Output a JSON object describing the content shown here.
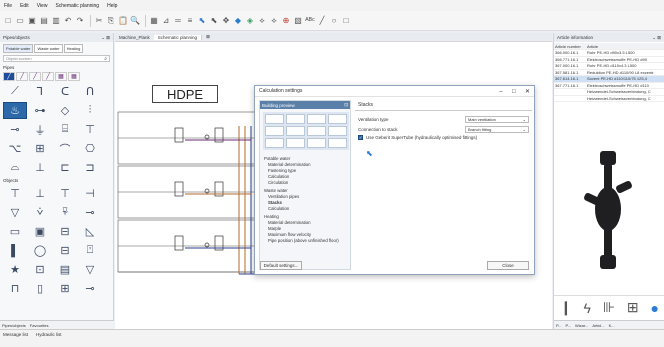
{
  "menu": [
    "File",
    "Edit",
    "View",
    "Schematic planning",
    "Help"
  ],
  "left": {
    "title": "Pipes/objects",
    "tabs": [
      "Potable water",
      "Waste water",
      "Heating"
    ],
    "search_placeholder": "Objekt suchen",
    "section_pipes": "Pipes",
    "section_objects": "Objects",
    "bottom_tabs": [
      "Pipes/objects",
      "Favourites"
    ]
  },
  "center": {
    "tabs": [
      "Machine_Plank",
      "Schematic planning"
    ],
    "hdpe_label": "HDPE"
  },
  "dialog": {
    "title": "Calculation settings",
    "left_header": "Building preview",
    "nav": [
      {
        "label": "Potable water",
        "level": 0
      },
      {
        "label": "Material determination",
        "level": 1
      },
      {
        "label": "Fastening type",
        "level": 1
      },
      {
        "label": "Calculation",
        "level": 1
      },
      {
        "label": "Circulation",
        "level": 1
      },
      {
        "label": "Waste water",
        "level": 0
      },
      {
        "label": "Ventilation pipes",
        "level": 1
      },
      {
        "label": "Stacks",
        "level": 1,
        "bold": true
      },
      {
        "label": "Calculation",
        "level": 1
      },
      {
        "label": "Heating",
        "level": 0
      },
      {
        "label": "Material determination",
        "level": 1
      },
      {
        "label": "Marple",
        "level": 1
      },
      {
        "label": "Maximum flow velocity",
        "level": 1
      },
      {
        "label": "Pipe position (above unfinished floor)",
        "level": 1
      }
    ],
    "section": "Stacks",
    "ventilation_label": "Ventilation type",
    "ventilation_value": "Main ventilation",
    "connection_label": "Connection to stack",
    "connection_value": "Branch fitting",
    "checkbox_label": "Use Geberit SuperTube (hydraulically optimised fittings)",
    "default_button": "Default settings...",
    "close_button": "Close"
  },
  "right": {
    "title": "Article information",
    "headers": [
      "Article number",
      "Article"
    ],
    "rows": [
      [
        "366.000.16.1",
        "Rohr PE-HD d90x3.5 L500"
      ],
      [
        "366.771.16.1",
        "Elektroschweissmuffe PE-HD d90"
      ],
      [
        "367.000.16.1",
        "Rohr PE-HD d110x4.3 L500"
      ],
      [
        "367.581.16.1",
        "Reduktion PE-HD d110/90 L8 exzentr"
      ],
      [
        "367.614.16.1",
        "Sovent PE-HD d110/110/75 125,4"
      ],
      [
        "367.771.16.1",
        "Elektroschweissmuffe PE-HD d110"
      ],
      [
        "",
        "Heizwendel-Schweissverbindung, C"
      ],
      [
        "",
        "Heizwendel-Schweissverbindung, C"
      ]
    ],
    "selected_row": 4,
    "bottom_tabs": [
      "P...",
      "P...",
      "Wizar...",
      "Articl...",
      "K..."
    ]
  },
  "status": {
    "line1": [
      "Message list",
      "Hydraulic list"
    ]
  }
}
